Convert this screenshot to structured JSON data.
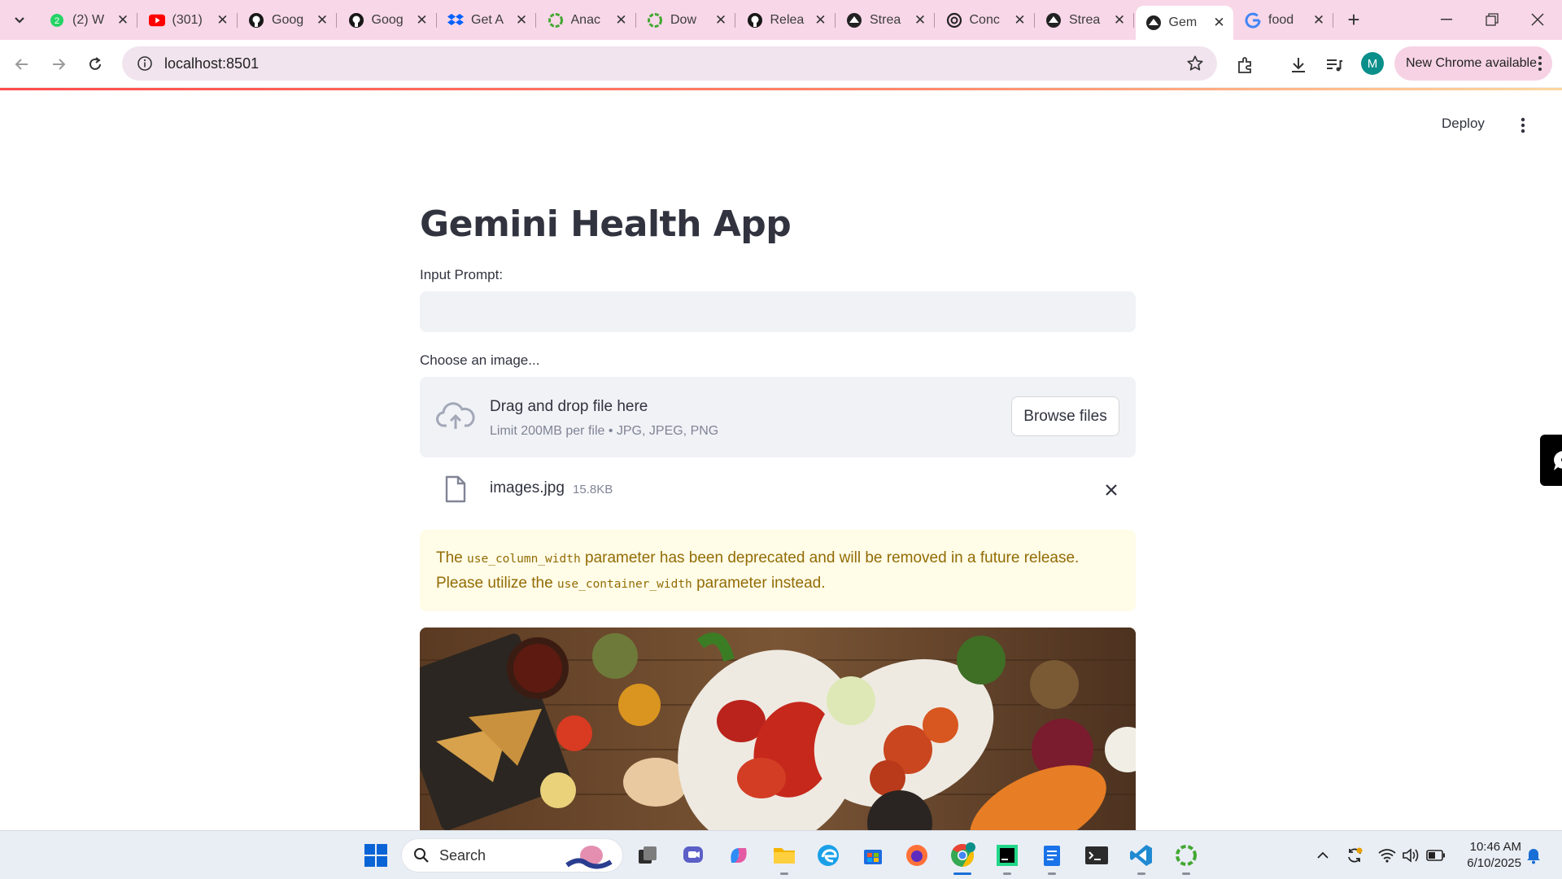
{
  "browser": {
    "tabs": [
      {
        "title": "(2) W",
        "favicon": "whatsapp-icon",
        "color": "#25d366"
      },
      {
        "title": "(301)",
        "favicon": "youtube-icon",
        "color": "#ff0000"
      },
      {
        "title": "Goog",
        "favicon": "github-icon",
        "color": "#181717"
      },
      {
        "title": "Goog",
        "favicon": "github-icon",
        "color": "#181717"
      },
      {
        "title": "Get A",
        "favicon": "dropbox-icon",
        "color": "#0061ff"
      },
      {
        "title": "Anac",
        "favicon": "anaconda-icon",
        "color": "#44a833"
      },
      {
        "title": "Dow",
        "favicon": "anaconda-icon",
        "color": "#44a833"
      },
      {
        "title": "Relea",
        "favicon": "github-icon",
        "color": "#181717"
      },
      {
        "title": "Strea",
        "favicon": "streamlit-icon",
        "color": "#222222"
      },
      {
        "title": "Conc",
        "favicon": "openai-icon",
        "color": "#222222"
      },
      {
        "title": "Strea",
        "favicon": "streamlit-icon",
        "color": "#222222"
      },
      {
        "title": "Gem",
        "favicon": "streamlit-icon",
        "color": "#222222",
        "active": true
      },
      {
        "title": "food",
        "favicon": "google-icon",
        "color": "#4285f4"
      }
    ],
    "url": "localhost:8501",
    "profile_initial": "M",
    "update_label": "New Chrome available"
  },
  "app": {
    "deploy_label": "Deploy",
    "title": "Gemini Health App",
    "input_label": "Input Prompt:",
    "input_value": "",
    "uploader_label": "Choose an image...",
    "drop_title": "Drag and drop file here",
    "drop_limit": "Limit 200MB per file • JPG, JPEG, PNG",
    "browse_label": "Browse files",
    "file_name": "images.jpg",
    "file_size": "15.8KB",
    "warning": {
      "part1": "The ",
      "code1": "use_column_width",
      "part2": " parameter has been deprecated and will be removed in a future release. Please utilize the ",
      "code2": "use_container_width",
      "part3": " parameter instead."
    }
  },
  "taskbar": {
    "search_placeholder": "Search",
    "time": "10:46 AM",
    "date": "6/10/2025"
  },
  "colors": {
    "accent": "#ff4b4b",
    "tabstrip": "#f8d7e8",
    "warning_bg": "#fffce7",
    "warning_text": "#926c05"
  }
}
